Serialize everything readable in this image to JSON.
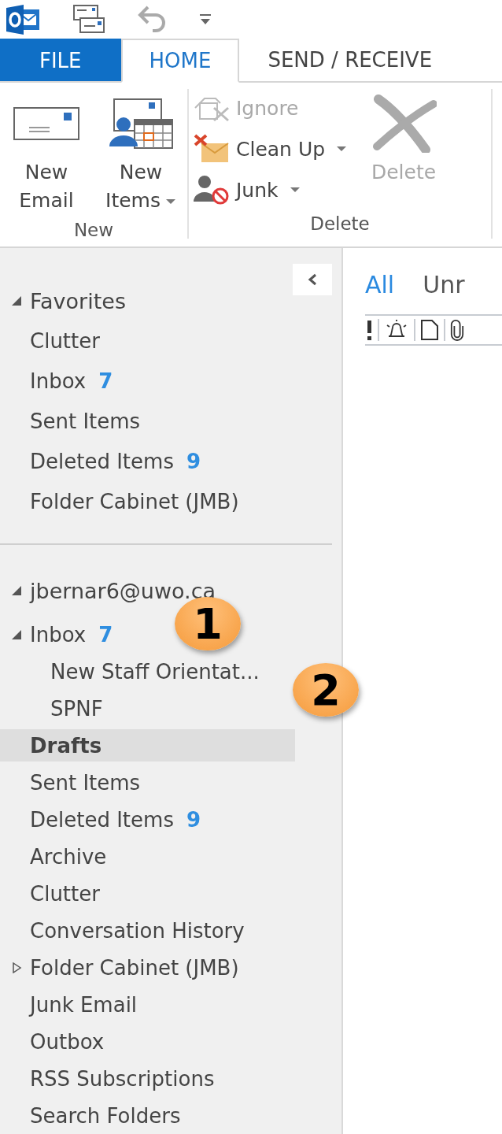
{
  "tabs": [
    {
      "label": "FILE",
      "kind": "file",
      "selected": false
    },
    {
      "label": "HOME",
      "kind": "tab",
      "selected": true
    },
    {
      "label": "SEND / RECEIVE",
      "kind": "tab",
      "selected": false
    }
  ],
  "ribbon": {
    "groups": [
      {
        "label": "New",
        "buttons": [
          {
            "label": "New Email",
            "kind": "large",
            "dropdown": false,
            "disabled": false
          },
          {
            "label": "New Items",
            "kind": "large",
            "dropdown": true,
            "disabled": false
          }
        ]
      },
      {
        "label": "Delete",
        "buttons": [
          {
            "label": "Ignore",
            "kind": "small",
            "dropdown": false,
            "disabled": true
          },
          {
            "label": "Clean Up",
            "kind": "small",
            "dropdown": true,
            "disabled": false
          },
          {
            "label": "Junk",
            "kind": "small",
            "dropdown": true,
            "disabled": false
          },
          {
            "label": "Delete",
            "kind": "large",
            "dropdown": false,
            "disabled": true
          }
        ]
      }
    ]
  },
  "favorites": {
    "label": "Favorites",
    "expanded": true,
    "items": [
      {
        "label": "Clutter"
      },
      {
        "label": "Inbox",
        "count": "7"
      },
      {
        "label": "Sent Items"
      },
      {
        "label": "Deleted Items",
        "count": "9"
      },
      {
        "label": "Folder Cabinet (JMB)"
      }
    ]
  },
  "account": {
    "label": "jbernar6@uwo.ca",
    "expanded": true,
    "children": [
      {
        "label": "Inbox",
        "count": "7",
        "expanded": true,
        "selected": false,
        "children": [
          {
            "label": "New Staff Orientat...",
            "selected": false
          },
          {
            "label": "SPNF",
            "selected": false
          }
        ]
      },
      {
        "label": "Drafts",
        "selected": true
      },
      {
        "label": "Sent Items",
        "selected": false
      },
      {
        "label": "Deleted Items",
        "count": "9",
        "selected": false
      },
      {
        "label": "Archive",
        "selected": false
      },
      {
        "label": "Clutter",
        "selected": false
      },
      {
        "label": "Conversation History",
        "selected": false
      },
      {
        "label": "Folder Cabinet (JMB)",
        "expanded": false,
        "selected": false
      },
      {
        "label": "Junk Email",
        "selected": false
      },
      {
        "label": "Outbox",
        "selected": false
      },
      {
        "label": "RSS Subscriptions",
        "selected": false
      },
      {
        "label": "Search Folders",
        "selected": false
      }
    ]
  },
  "filters": [
    {
      "label": "All",
      "selected": true
    },
    {
      "label": "Unr",
      "selected": false
    }
  ],
  "columns": [
    {
      "kind": "importance"
    },
    {
      "kind": "reminder"
    },
    {
      "kind": "type"
    },
    {
      "kind": "attachment"
    }
  ],
  "callouts": [
    {
      "label": "1"
    },
    {
      "label": "2"
    }
  ]
}
